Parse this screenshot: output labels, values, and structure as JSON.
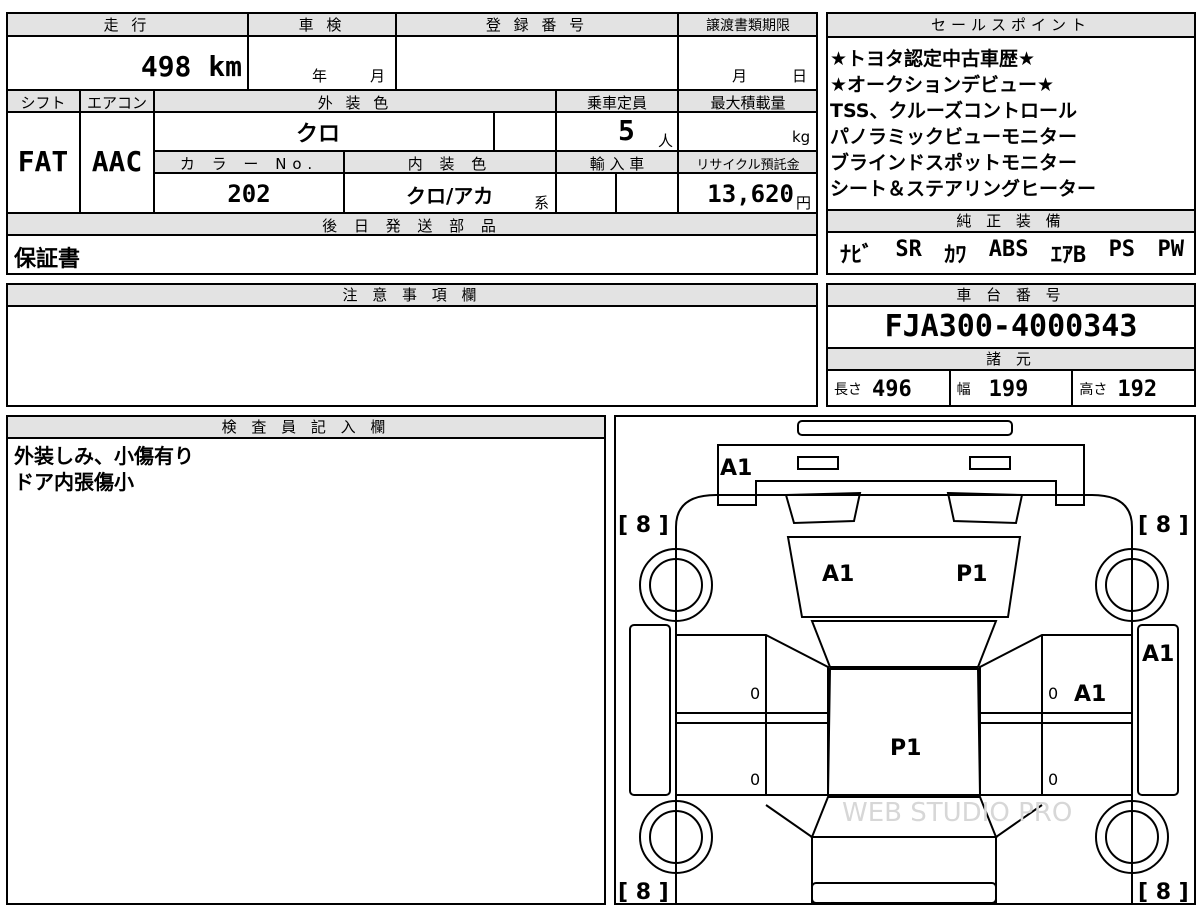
{
  "main_sheet": {
    "headers": {
      "mileage": "走 行",
      "inspection": "車 検",
      "registration_number": "登 録 番 号",
      "transfer_deadline": "譲渡書類期限",
      "shift": "シフト",
      "aircon": "エアコン",
      "exterior_color": "外 装 色",
      "capacity": "乗車定員",
      "max_load": "最大積載量",
      "color_no": "カ ラ ー No.",
      "interior_color": "内 装 色",
      "import": "輸 入 車",
      "recycle_fee": "リサイクル預託金",
      "later_parts": "後 日 発 送 部 品",
      "notes": "注 意 事 項 欄",
      "inspector": "検 査 員 記 入 欄"
    },
    "mileage_value": "498",
    "mileage_unit": "km",
    "inspection_year": "年",
    "inspection_month": "月",
    "deadline_month": "月",
    "deadline_day": "日",
    "shift_value": "FAT",
    "aircon_value": "AAC",
    "exterior_color_value": "クロ",
    "capacity_value": "5",
    "capacity_unit": "人",
    "max_load_unit": "kg",
    "color_no_value": "202",
    "interior_color_value": "クロ/アカ",
    "interior_suffix": "系",
    "recycle_value": "13,620",
    "recycle_unit": "円",
    "later_parts_value": "保証書",
    "inspector_lines": [
      "外装しみ、小傷有り",
      "ドア内張傷小"
    ]
  },
  "sales": {
    "header": "セールスポイント",
    "lines": [
      "★トヨタ認定中古車歴★",
      "★オークションデビュー★",
      "TSS、クルーズコントロール",
      "パノラミックビューモニター",
      "ブラインドスポットモニター",
      "シート＆ステアリングヒーター"
    ]
  },
  "equipment": {
    "header": "純 正 装 備",
    "items": [
      "ﾅﾋﾞ",
      "SR",
      "ｶﾜ",
      "ABS",
      "ｴｱB",
      "PS",
      "PW"
    ]
  },
  "chassis": {
    "header": "車 台 番 号",
    "number": "FJA300-4000343"
  },
  "specs": {
    "header": "諸 元",
    "length_label": "長さ",
    "length_value": "496",
    "width_label": "幅",
    "width_value": "199",
    "height_label": "高さ",
    "height_value": "192"
  },
  "diagram": {
    "tires": [
      "[ 8 ]",
      "[ 8 ]",
      "[ 8 ]",
      "[ 8 ]"
    ],
    "marks": {
      "front_bumper": "A1",
      "hood_left": "A1",
      "hood_right": "P1",
      "roof": "P1",
      "right_fender": "A1",
      "right_front_door": "A1"
    },
    "door_values": [
      "0",
      "0",
      "0",
      "0"
    ],
    "watermark": "WEB STUDIO PRO"
  }
}
